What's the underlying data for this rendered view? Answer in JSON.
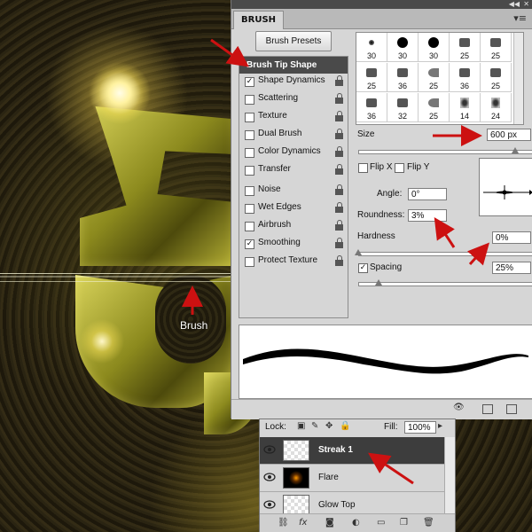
{
  "artwork": {
    "brush_caption": "Brush"
  },
  "panel": {
    "tab_title": "BRUSH",
    "menu_icon": "panel-menu-icon",
    "presets_button": "Brush Presets",
    "options_header": "Brush Tip Shape",
    "options": [
      {
        "label": "Shape Dynamics",
        "checked": true
      },
      {
        "label": "Scattering",
        "checked": false
      },
      {
        "label": "Texture",
        "checked": false
      },
      {
        "label": "Dual Brush",
        "checked": false
      },
      {
        "label": "Color Dynamics",
        "checked": false
      },
      {
        "label": "Transfer",
        "checked": false
      },
      {
        "label": "Noise",
        "checked": false
      },
      {
        "label": "Wet Edges",
        "checked": false
      },
      {
        "label": "Airbrush",
        "checked": false
      },
      {
        "label": "Smoothing",
        "checked": true
      },
      {
        "label": "Protect Texture",
        "checked": false
      }
    ],
    "presets": [
      "30",
      "30",
      "30",
      "25",
      "25",
      "25",
      "36",
      "25",
      "36",
      "25",
      "36",
      "32",
      "25",
      "14",
      "24"
    ],
    "size_label": "Size",
    "size_value": "600 px",
    "flip_x": "Flip X",
    "flip_y": "Flip Y",
    "angle_label": "Angle:",
    "angle_value": "0°",
    "roundness_label": "Roundness:",
    "roundness_value": "3%",
    "hardness_label": "Hardness",
    "hardness_value": "0%",
    "spacing_label": "Spacing",
    "spacing_checked": true,
    "spacing_value": "25%"
  },
  "layers": {
    "lock_label": "Lock:",
    "fill_label": "Fill:",
    "fill_value": "100%",
    "rows": [
      {
        "name": "Streak 1",
        "selected": true
      },
      {
        "name": "Flare",
        "selected": false
      },
      {
        "name": "Glow Top",
        "selected": false
      }
    ]
  },
  "colors": {
    "panel_bg": "#d6d6d6",
    "header_dark": "#4a4a4a",
    "selected_layer": "#3d3d3d",
    "annotation_arrow": "#cc1111"
  }
}
